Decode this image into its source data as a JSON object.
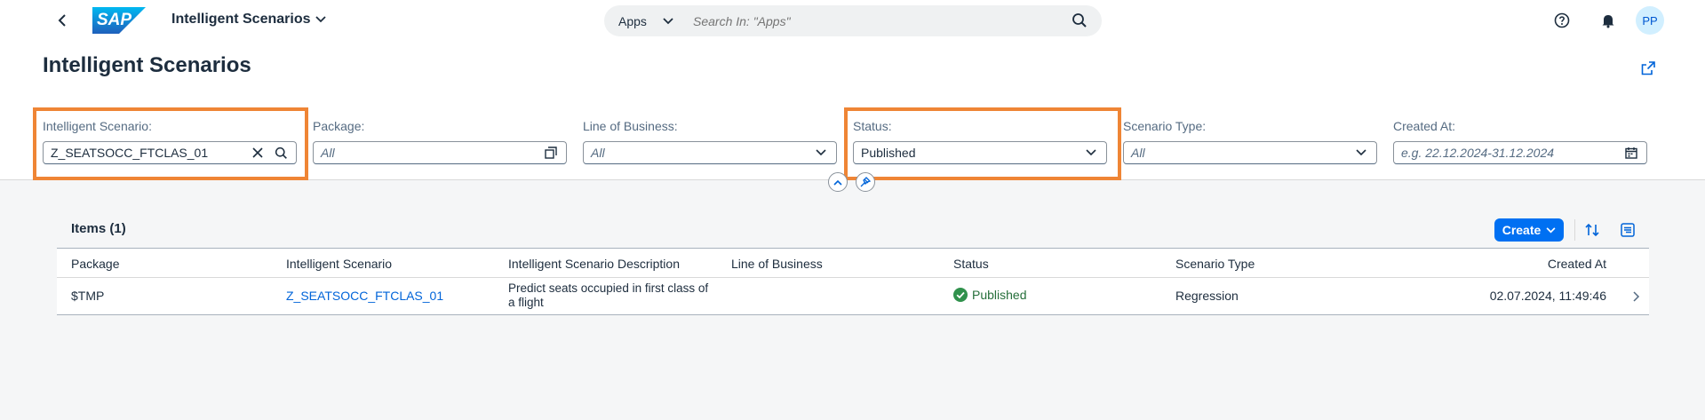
{
  "shell": {
    "logo_text": "SAP",
    "app_title": "Intelligent Scenarios",
    "search_scope": "Apps",
    "search_placeholder": "Search In: \"Apps\"",
    "avatar_initials": "PP"
  },
  "header": {
    "page_title": "Intelligent Scenarios"
  },
  "filters": {
    "intelligent_scenario": {
      "label": "Intelligent Scenario:",
      "value": "Z_SEATSOCC_FTCLAS_01"
    },
    "package": {
      "label": "Package:",
      "placeholder": "All"
    },
    "line_of_business": {
      "label": "Line of Business:",
      "placeholder": "All"
    },
    "status": {
      "label": "Status:",
      "value": "Published"
    },
    "scenario_type": {
      "label": "Scenario Type:",
      "placeholder": "All"
    },
    "created_at": {
      "label": "Created At:",
      "placeholder": "e.g. 22.12.2024-31.12.2024"
    }
  },
  "table": {
    "title": "Items (1)",
    "create_label": "Create",
    "columns": [
      "Package",
      "Intelligent Scenario",
      "Intelligent Scenario Description",
      "Line of Business",
      "Status",
      "Scenario Type",
      "Created At"
    ],
    "rows": [
      {
        "package": "$TMP",
        "scenario": "Z_SEATSOCC_FTCLAS_01",
        "description_line1": "Predict seats occupied in first class of",
        "description_line2": "a flight",
        "line_of_business": "",
        "status": "Published",
        "scenario_type": "Regression",
        "created_at": "02.07.2024, 11:49:46"
      }
    ]
  },
  "colors": {
    "accent": "#0070f2",
    "highlight": "#ef8535",
    "success": "#256f3a"
  }
}
